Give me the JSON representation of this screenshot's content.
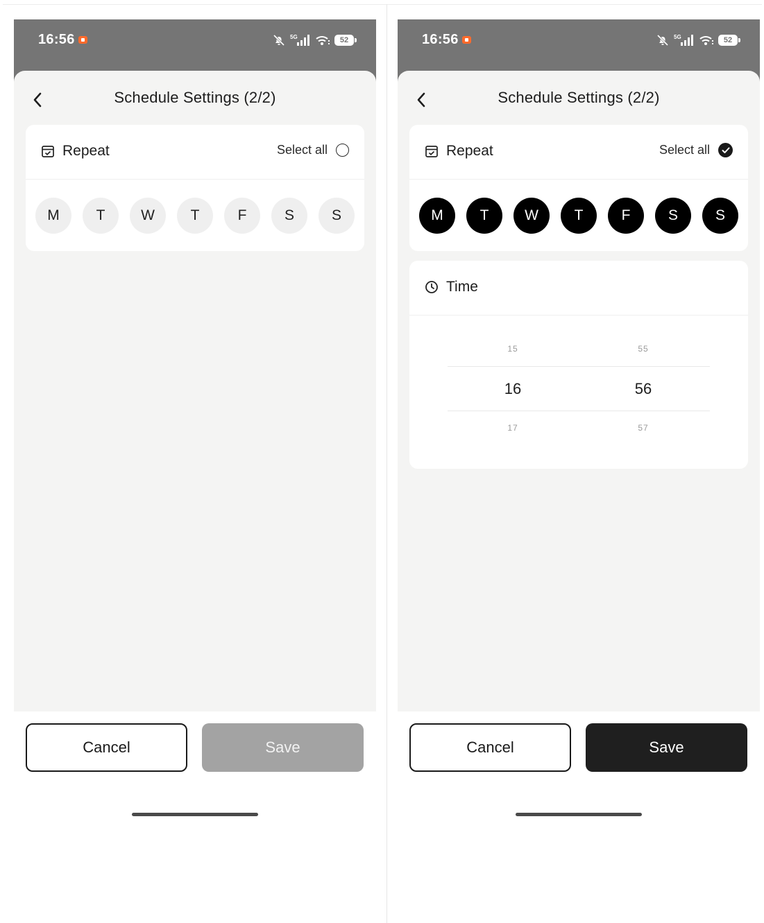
{
  "status_bar": {
    "time": "16:56",
    "network": "5G",
    "battery": "52"
  },
  "left_screen": {
    "title": "Schedule Settings (2/2)",
    "repeat": {
      "label": "Repeat",
      "select_all_label": "Select all",
      "select_all_checked": false
    },
    "days": [
      {
        "label": "M",
        "selected": false
      },
      {
        "label": "T",
        "selected": false
      },
      {
        "label": "W",
        "selected": false
      },
      {
        "label": "T",
        "selected": false
      },
      {
        "label": "F",
        "selected": false
      },
      {
        "label": "S",
        "selected": false
      },
      {
        "label": "S",
        "selected": false
      }
    ],
    "buttons": {
      "cancel": "Cancel",
      "save": "Save",
      "save_enabled": false
    }
  },
  "right_screen": {
    "title": "Schedule Settings (2/2)",
    "repeat": {
      "label": "Repeat",
      "select_all_label": "Select all",
      "select_all_checked": true
    },
    "days": [
      {
        "label": "M",
        "selected": true
      },
      {
        "label": "T",
        "selected": true
      },
      {
        "label": "W",
        "selected": true
      },
      {
        "label": "T",
        "selected": true
      },
      {
        "label": "F",
        "selected": true
      },
      {
        "label": "S",
        "selected": true
      },
      {
        "label": "S",
        "selected": true
      }
    ],
    "time": {
      "label": "Time",
      "hours": {
        "prev": "15",
        "current": "16",
        "next": "17"
      },
      "minutes": {
        "prev": "55",
        "current": "56",
        "next": "57"
      }
    },
    "buttons": {
      "cancel": "Cancel",
      "save": "Save",
      "save_enabled": true
    }
  },
  "colors": {
    "status_bar": "#757575",
    "sheet_background": "#f4f4f3",
    "day_selected": "#000000",
    "day_unselected": "#efefef",
    "save_disabled": "#a3a3a3",
    "save_enabled": "#1f1f1f",
    "recording_indicator": "#ff6a2b"
  },
  "icons": {
    "back": "chevron-left-icon",
    "repeat": "calendar-check-icon",
    "time": "clock-icon",
    "select_all_off": "radio-empty-icon",
    "select_all_on": "check-circle-icon"
  }
}
